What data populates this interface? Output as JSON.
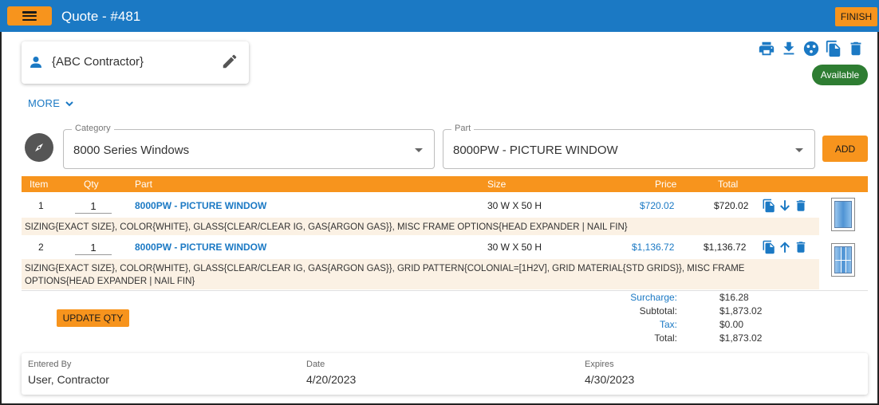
{
  "header": {
    "title": "Quote - #481",
    "finish_label": "FINISH"
  },
  "contractor": {
    "name": "{ABC Contractor}"
  },
  "status": {
    "badge": "Available"
  },
  "more": {
    "label": "MORE"
  },
  "selectors": {
    "category": {
      "label": "Category",
      "value": "8000 Series Windows"
    },
    "part": {
      "label": "Part",
      "value": "8000PW - PICTURE WINDOW"
    },
    "add_label": "ADD"
  },
  "table": {
    "headers": {
      "item": "Item",
      "qty": "Qty",
      "part": "Part",
      "size": "Size",
      "price": "Price",
      "total": "Total"
    },
    "rows": [
      {
        "item": "1",
        "qty": "1",
        "part": "8000PW - PICTURE WINDOW",
        "size": "30 W X 50 H",
        "price": "$720.02",
        "total": "$720.02",
        "description": "SIZING{EXACT SIZE}, COLOR{WHITE}, GLASS{CLEAR/CLEAR IG, GAS{ARGON GAS}}, MISC FRAME OPTIONS{HEAD EXPANDER | NAIL FIN}"
      },
      {
        "item": "2",
        "qty": "1",
        "part": "8000PW - PICTURE WINDOW",
        "size": "30 W X 50 H",
        "price": "$1,136.72",
        "total": "$1,136.72",
        "description": "SIZING{EXACT SIZE}, COLOR{WHITE}, GLASS{CLEAR/CLEAR IG, GAS{ARGON GAS}}, GRID PATTERN{COLONIAL=[1H2V], GRID MATERIAL{STD GRIDS}}, MISC FRAME OPTIONS{HEAD EXPANDER | NAIL FIN}"
      }
    ]
  },
  "totals": {
    "update_label": "UPDATE QTY",
    "surcharge_label": "Surcharge:",
    "surcharge": "$16.28",
    "subtotal_label": "Subtotal:",
    "subtotal": "$1,873.02",
    "tax_label": "Tax:",
    "tax": "$0.00",
    "total_label": "Total:",
    "total": "$1,873.02"
  },
  "footer": {
    "entered_by_label": "Entered By",
    "entered_by": "User, Contractor",
    "date_label": "Date",
    "date": "4/20/2023",
    "expires_label": "Expires",
    "expires": "4/30/2023"
  },
  "colors": {
    "header_blue": "#1b79c4",
    "accent_orange": "#f7941d",
    "badge_green": "#2e7d32",
    "desc_bg": "#fbf1e4"
  }
}
